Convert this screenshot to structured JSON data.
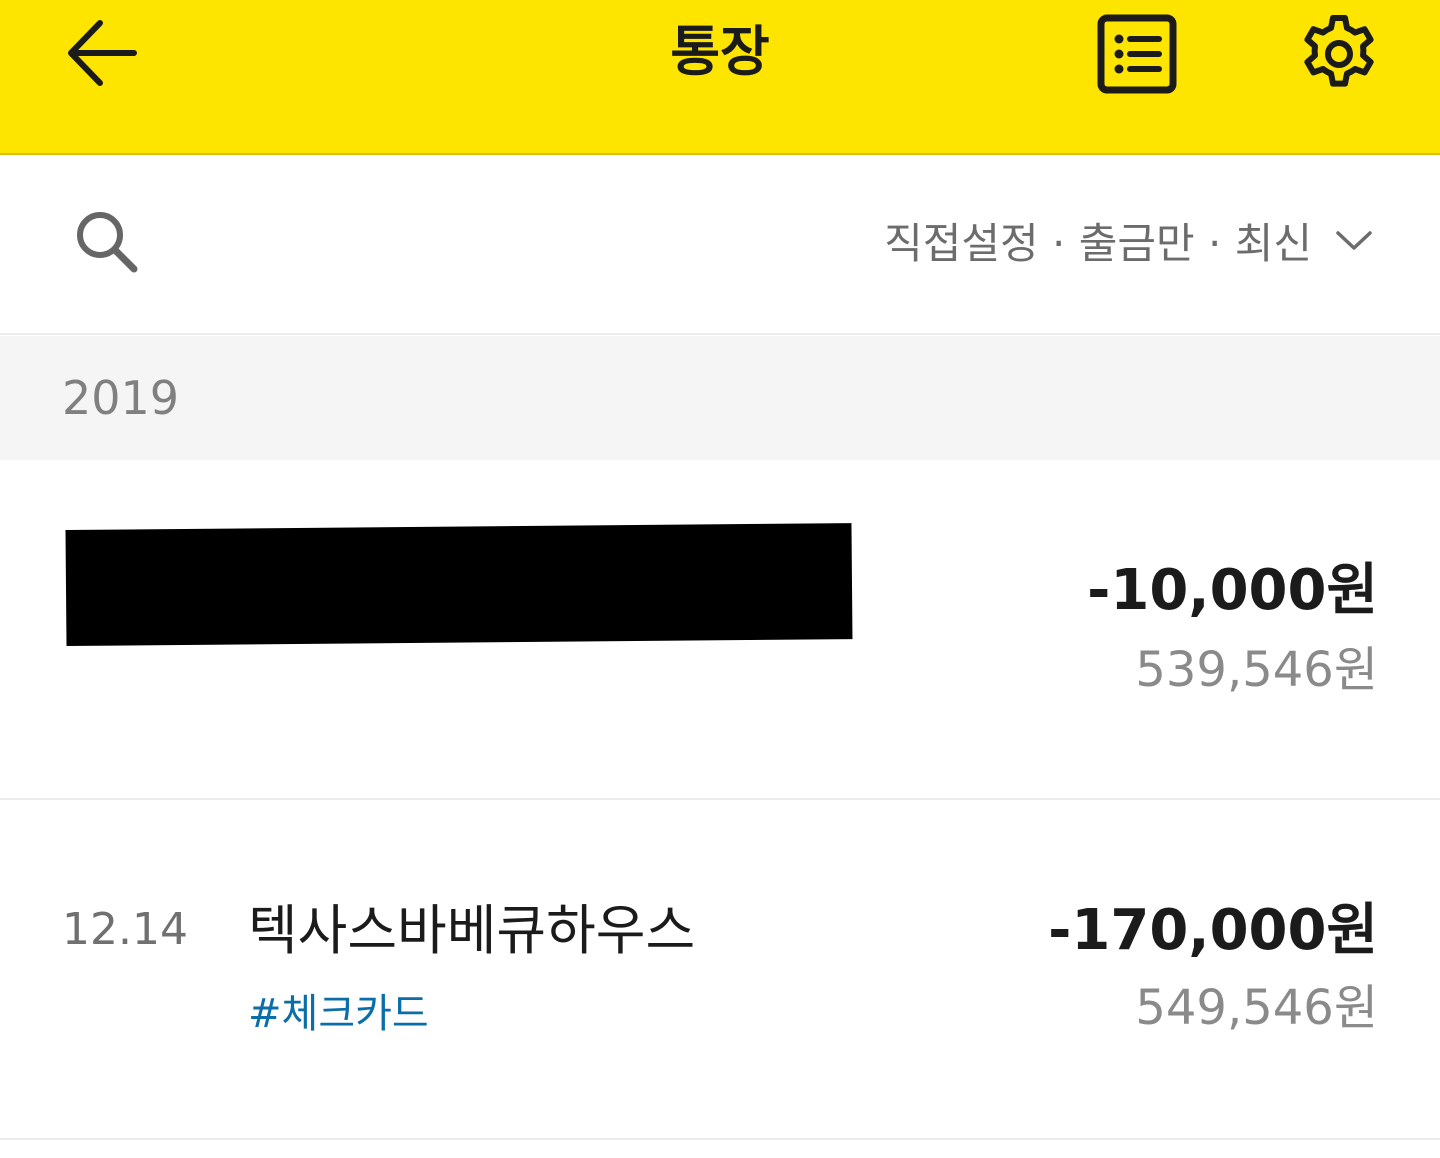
{
  "header": {
    "title": "통장",
    "back_icon": "arrow-left-icon",
    "list_icon": "list-icon",
    "settings_icon": "gear-icon",
    "background_color": "#FEE500"
  },
  "filter": {
    "search_icon": "search-icon",
    "label": "직접설정 · 출금만 · 최신",
    "chevron_icon": "chevron-down-icon"
  },
  "year_group": {
    "year": "2019"
  },
  "transactions": [
    {
      "date": "",
      "merchant": "",
      "redacted": true,
      "amount": "-10,000원",
      "balance": "539,546원"
    },
    {
      "date": "12.14",
      "merchant": "텍사스바베큐하우스",
      "tag": "#체크카드",
      "amount": "-170,000원",
      "balance": "549,546원"
    }
  ],
  "colors": {
    "accent_yellow": "#FEE500",
    "tag_blue": "#0a6ea8",
    "text_primary": "#1b1b1b",
    "text_secondary": "#8a8a8a"
  }
}
